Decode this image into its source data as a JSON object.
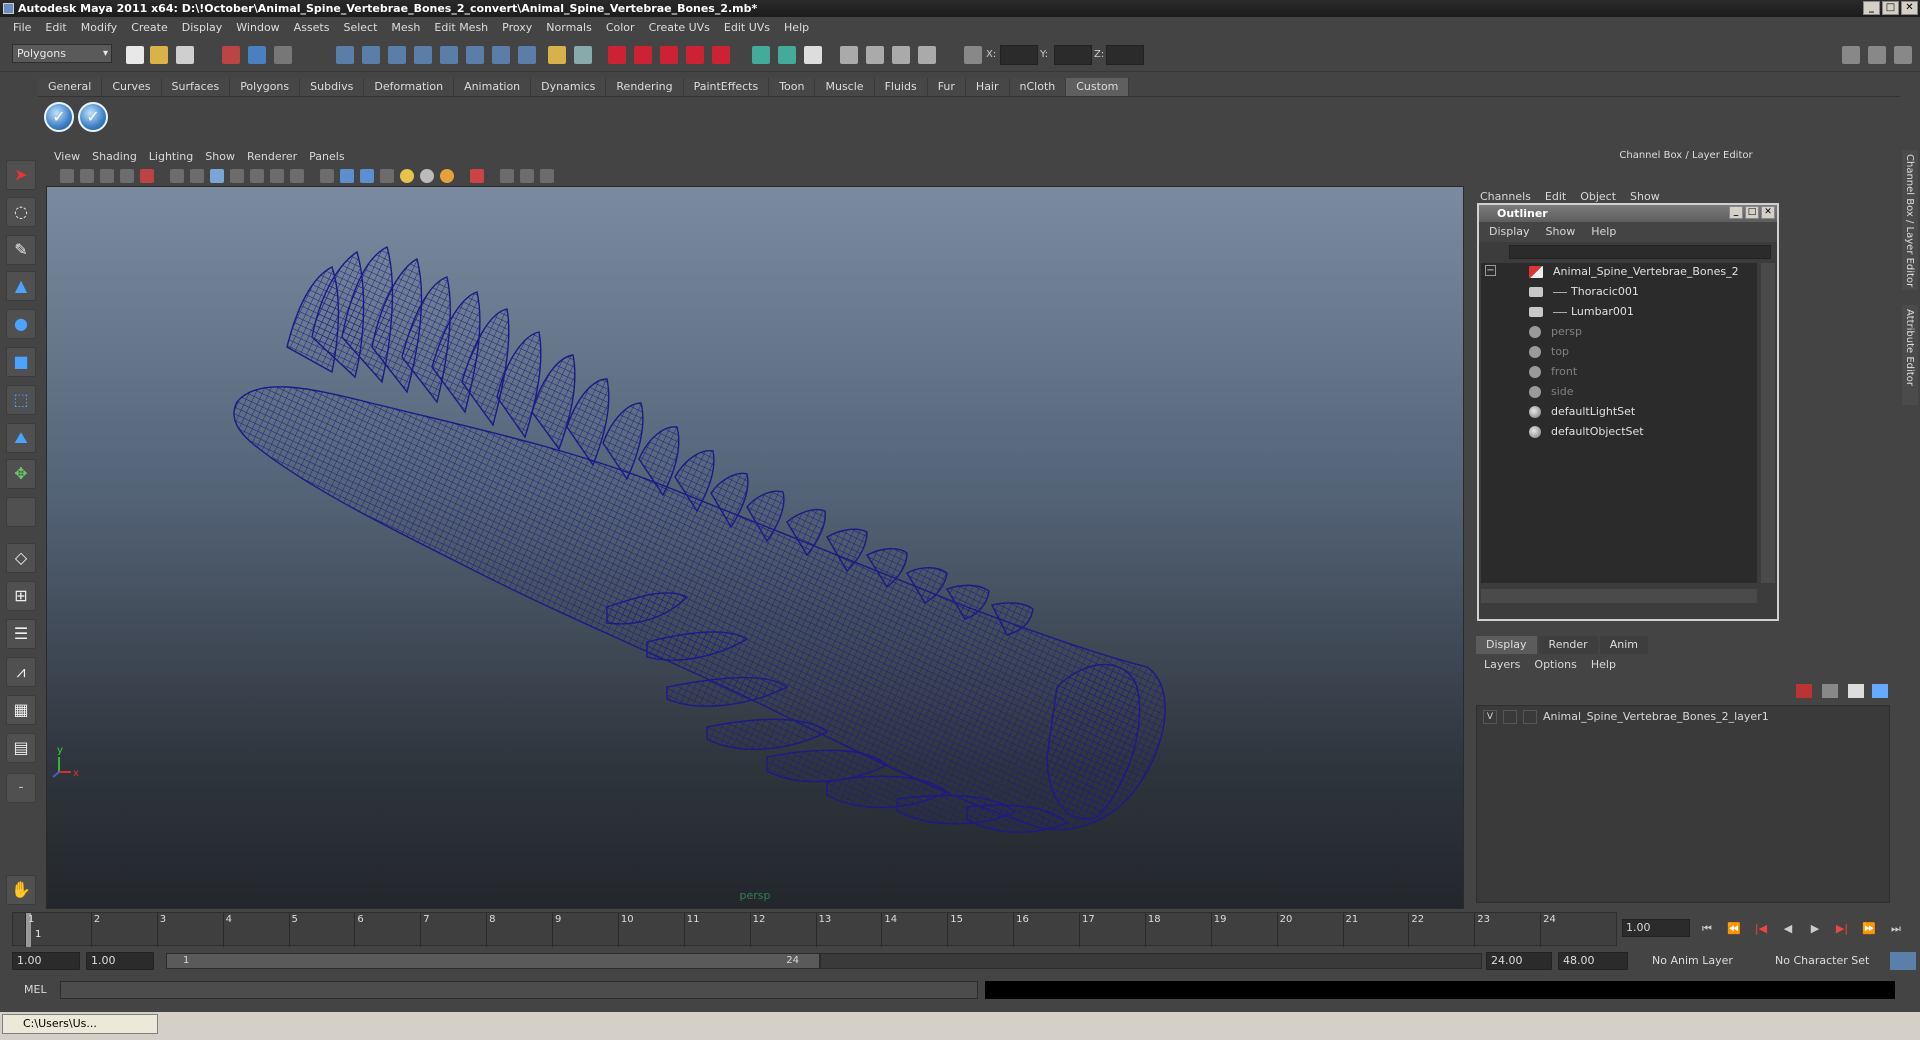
{
  "window": {
    "title": "Autodesk Maya 2011 x64: D:\\!October\\Animal_Spine_Vertebrae_Bones_2_convert\\Animal_Spine_Vertebrae_Bones_2.mb*",
    "btn_min": "_",
    "btn_max": "□",
    "btn_close": "✕"
  },
  "menubar": [
    "File",
    "Edit",
    "Modify",
    "Create",
    "Display",
    "Window",
    "Assets",
    "Select",
    "Mesh",
    "Edit Mesh",
    "Proxy",
    "Normals",
    "Color",
    "Create UVs",
    "Edit UVs",
    "Help"
  ],
  "statusline": {
    "mode": "Polygons",
    "x_label": "X:",
    "y_label": "Y:",
    "z_label": "Z:"
  },
  "shelf": {
    "tabs": [
      "General",
      "Curves",
      "Surfaces",
      "Polygons",
      "Subdivs",
      "Deformation",
      "Animation",
      "Dynamics",
      "Rendering",
      "PaintEffects",
      "Toon",
      "Muscle",
      "Fluids",
      "Fur",
      "Hair",
      "nCloth",
      "Custom"
    ],
    "active_tab": "Custom",
    "buttons": [
      "check-icon",
      "check-icon"
    ]
  },
  "viewport": {
    "menu": [
      "View",
      "Shading",
      "Lighting",
      "Show",
      "Renderer",
      "Panels"
    ],
    "camera": "persp",
    "axis_x": "x",
    "axis_y": "y",
    "wire_color": "#1c1a86"
  },
  "channelbox": {
    "title": "Channel Box / Layer Editor",
    "menu": [
      "Channels",
      "Edit",
      "Object",
      "Show"
    ]
  },
  "outliner": {
    "title": "Outliner",
    "menu": [
      "Display",
      "Show",
      "Help"
    ],
    "collapse": "−",
    "items": [
      {
        "label": "Animal_Spine_Vertebrae_Bones_2",
        "icon": "transform-icon",
        "dim": false,
        "indent": 0
      },
      {
        "label": "Thoracic001",
        "icon": "mesh-icon",
        "dim": false,
        "indent": 1
      },
      {
        "label": "Lumbar001",
        "icon": "mesh-icon",
        "dim": false,
        "indent": 1
      },
      {
        "label": "persp",
        "icon": "camera-icon",
        "dim": true,
        "indent": 0
      },
      {
        "label": "top",
        "icon": "camera-icon",
        "dim": true,
        "indent": 0
      },
      {
        "label": "front",
        "icon": "camera-icon",
        "dim": true,
        "indent": 0
      },
      {
        "label": "side",
        "icon": "camera-icon",
        "dim": true,
        "indent": 0
      },
      {
        "label": "defaultLightSet",
        "icon": "set-icon",
        "dim": false,
        "indent": 0
      },
      {
        "label": "defaultObjectSet",
        "icon": "set-icon",
        "dim": false,
        "indent": 0
      }
    ]
  },
  "layers": {
    "tabs": [
      "Display",
      "Render",
      "Anim"
    ],
    "active_tab": "Display",
    "menu": [
      "Layers",
      "Options",
      "Help"
    ],
    "rows": [
      {
        "visible": "V",
        "name": "Animal_Spine_Vertebrae_Bones_2_layer1"
      }
    ]
  },
  "side_tabs": [
    "Channel Box / Layer Editor",
    "Attribute Editor"
  ],
  "timeslider": {
    "ticks": [
      "1",
      "2",
      "3",
      "4",
      "5",
      "6",
      "7",
      "8",
      "9",
      "10",
      "11",
      "12",
      "13",
      "14",
      "15",
      "16",
      "17",
      "18",
      "19",
      "20",
      "21",
      "22",
      "23",
      "24"
    ],
    "current_frame": "1",
    "current_time": "1.00",
    "play_buttons": [
      "⏮",
      "⏪",
      "|◀",
      "◀",
      "▶",
      "▶|",
      "⏩",
      "⏭"
    ]
  },
  "range": {
    "start_time": "1.00",
    "playback_start": "1.00",
    "slider_start": "1",
    "slider_end": "24",
    "playback_end": "24.00",
    "end_time": "48.00",
    "anim_layer": "No Anim Layer",
    "character_set": "No Character Set"
  },
  "cmdline": {
    "label": "MEL"
  },
  "taskbar": {
    "task": "C:\\Users\\Us..."
  }
}
